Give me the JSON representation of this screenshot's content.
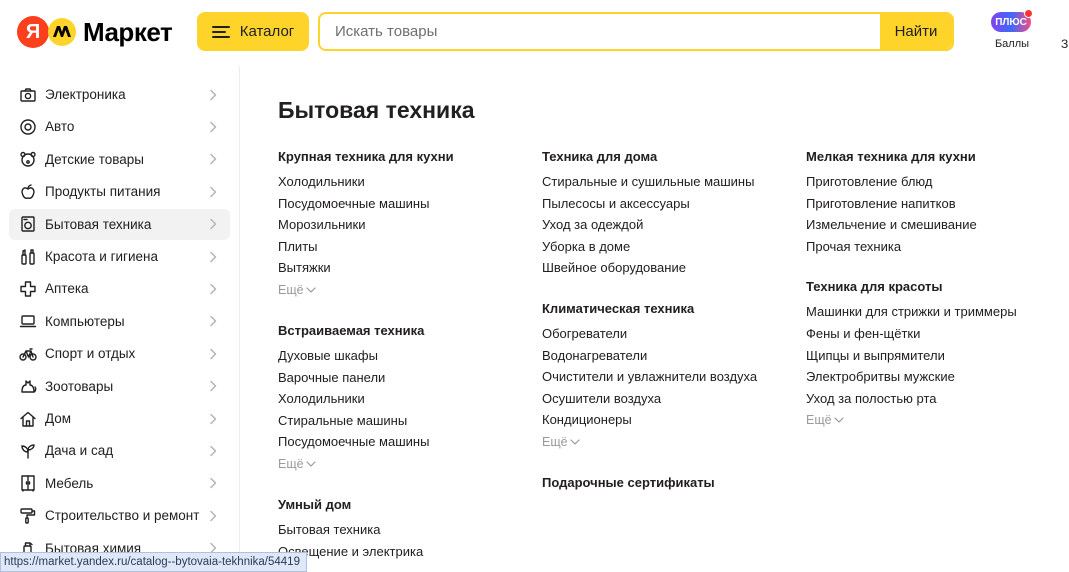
{
  "header": {
    "logo_text": "Маркет",
    "logo_letter": "Я",
    "catalog_label": "Каталог",
    "search_placeholder": "Искать товары",
    "search_button": "Найти",
    "plus_badge": "ПЛЮС",
    "plus_label": "Баллы",
    "edge_char": "З"
  },
  "sidebar": {
    "items": [
      {
        "label": "Электроника",
        "icon": "camera-icon"
      },
      {
        "label": "Авто",
        "icon": "wheel-icon"
      },
      {
        "label": "Детские товары",
        "icon": "bear-icon"
      },
      {
        "label": "Продукты питания",
        "icon": "apple-icon"
      },
      {
        "label": "Бытовая техника",
        "icon": "washing-machine-icon",
        "active": true
      },
      {
        "label": "Красота и гигиена",
        "icon": "beauty-icon"
      },
      {
        "label": "Аптека",
        "icon": "cross-icon"
      },
      {
        "label": "Компьютеры",
        "icon": "laptop-icon"
      },
      {
        "label": "Спорт и отдых",
        "icon": "bicycle-icon"
      },
      {
        "label": "Зоотовары",
        "icon": "cat-icon"
      },
      {
        "label": "Дом",
        "icon": "house-icon"
      },
      {
        "label": "Дача и сад",
        "icon": "sprout-icon"
      },
      {
        "label": "Мебель",
        "icon": "wardrobe-icon"
      },
      {
        "label": "Строительство и ремонт",
        "icon": "paint-roller-icon"
      },
      {
        "label": "Бытовая химия",
        "icon": "spray-icon"
      }
    ]
  },
  "main": {
    "title": "Бытовая техника",
    "more_label": "Ещё",
    "columns": [
      {
        "groups": [
          {
            "title": "Крупная техника для кухни",
            "links": [
              "Холодильники",
              "Посудомоечные машины",
              "Морозильники",
              "Плиты",
              "Вытяжки"
            ],
            "more": true
          },
          {
            "title": "Встраиваемая техника",
            "links": [
              "Духовые шкафы",
              "Варочные панели",
              "Холодильники",
              "Стиральные машины",
              "Посудомоечные машины"
            ],
            "more": true
          },
          {
            "title": "Умный дом",
            "links": [
              "Бытовая техника",
              "Освещение и электрика"
            ],
            "more": false
          }
        ]
      },
      {
        "groups": [
          {
            "title": "Техника для дома",
            "links": [
              "Стиральные и сушильные машины",
              "Пылесосы и аксессуары",
              "Уход за одеждой",
              "Уборка в доме",
              "Швейное оборудование"
            ],
            "more": false
          },
          {
            "title": "Климатическая техника",
            "links": [
              "Обогреватели",
              "Водонагреватели",
              "Очистители и увлажнители воздуха",
              "Осушители воздуха",
              "Кондиционеры"
            ],
            "more": true
          },
          {
            "title": "Подарочные сертификаты",
            "links": [],
            "more": false
          }
        ]
      },
      {
        "groups": [
          {
            "title": "Мелкая техника для кухни",
            "links": [
              "Приготовление блюд",
              "Приготовление напитков",
              "Измельчение и смешивание",
              "Прочая техника"
            ],
            "more": false
          },
          {
            "title": "Техника для красоты",
            "links": [
              "Машинки для стрижки и триммеры",
              "Фены и фен-щётки",
              "Щипцы и выпрямители",
              "Электробритвы мужские",
              "Уход за полостью рта"
            ],
            "more": true
          }
        ]
      }
    ]
  },
  "status_bar": {
    "url": "https://market.yandex.ru/catalog--bytovaia-tekhnika/54419"
  },
  "colors": {
    "accent": "#fed42b",
    "logo_red": "#fc3f1d",
    "active_bg": "#f2f2f2"
  }
}
